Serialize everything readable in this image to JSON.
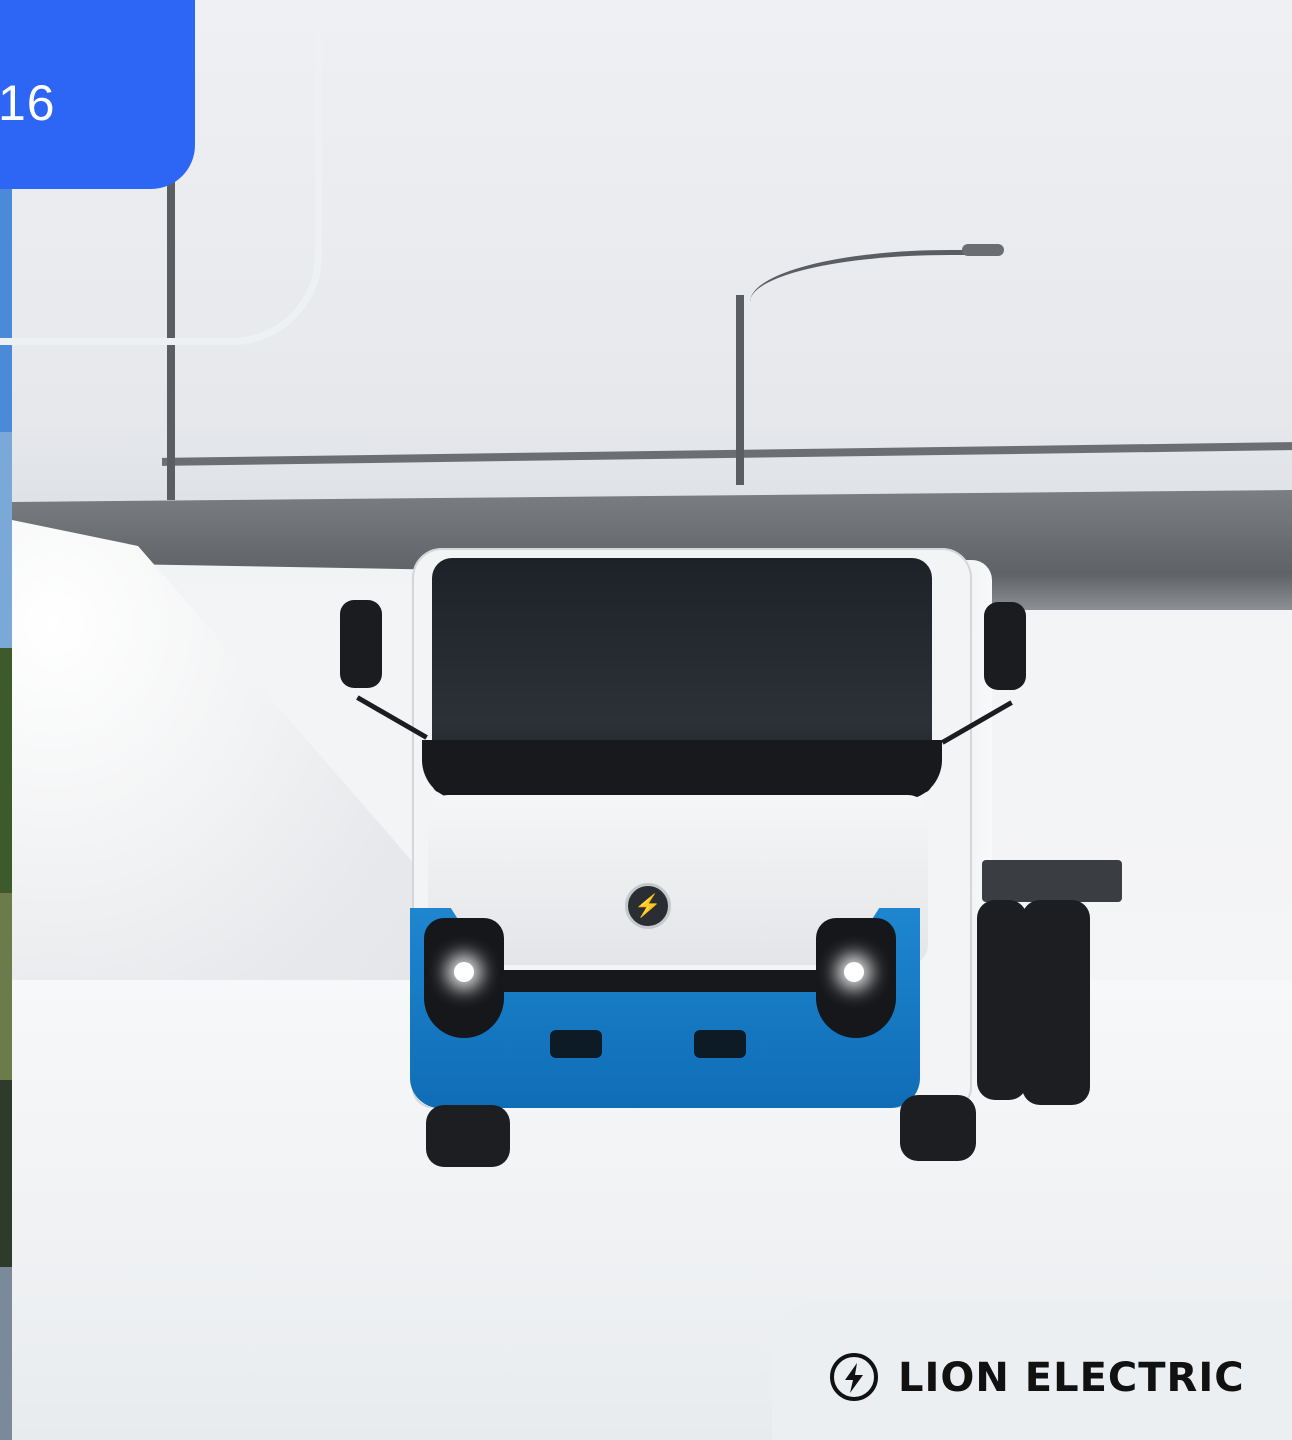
{
  "date_badge": {
    "visible_text": "16"
  },
  "logo": {
    "text": "LION ELECTRIC",
    "icon": "lightning-bolt-circle-icon"
  },
  "photo": {
    "subject": "electric-truck-in-snow"
  },
  "colors": {
    "badge_blue": "#2D66F5",
    "truck_blue": "#1A7FCB",
    "panel_bg": "#ECEFF2",
    "logo_black": "#111111"
  }
}
